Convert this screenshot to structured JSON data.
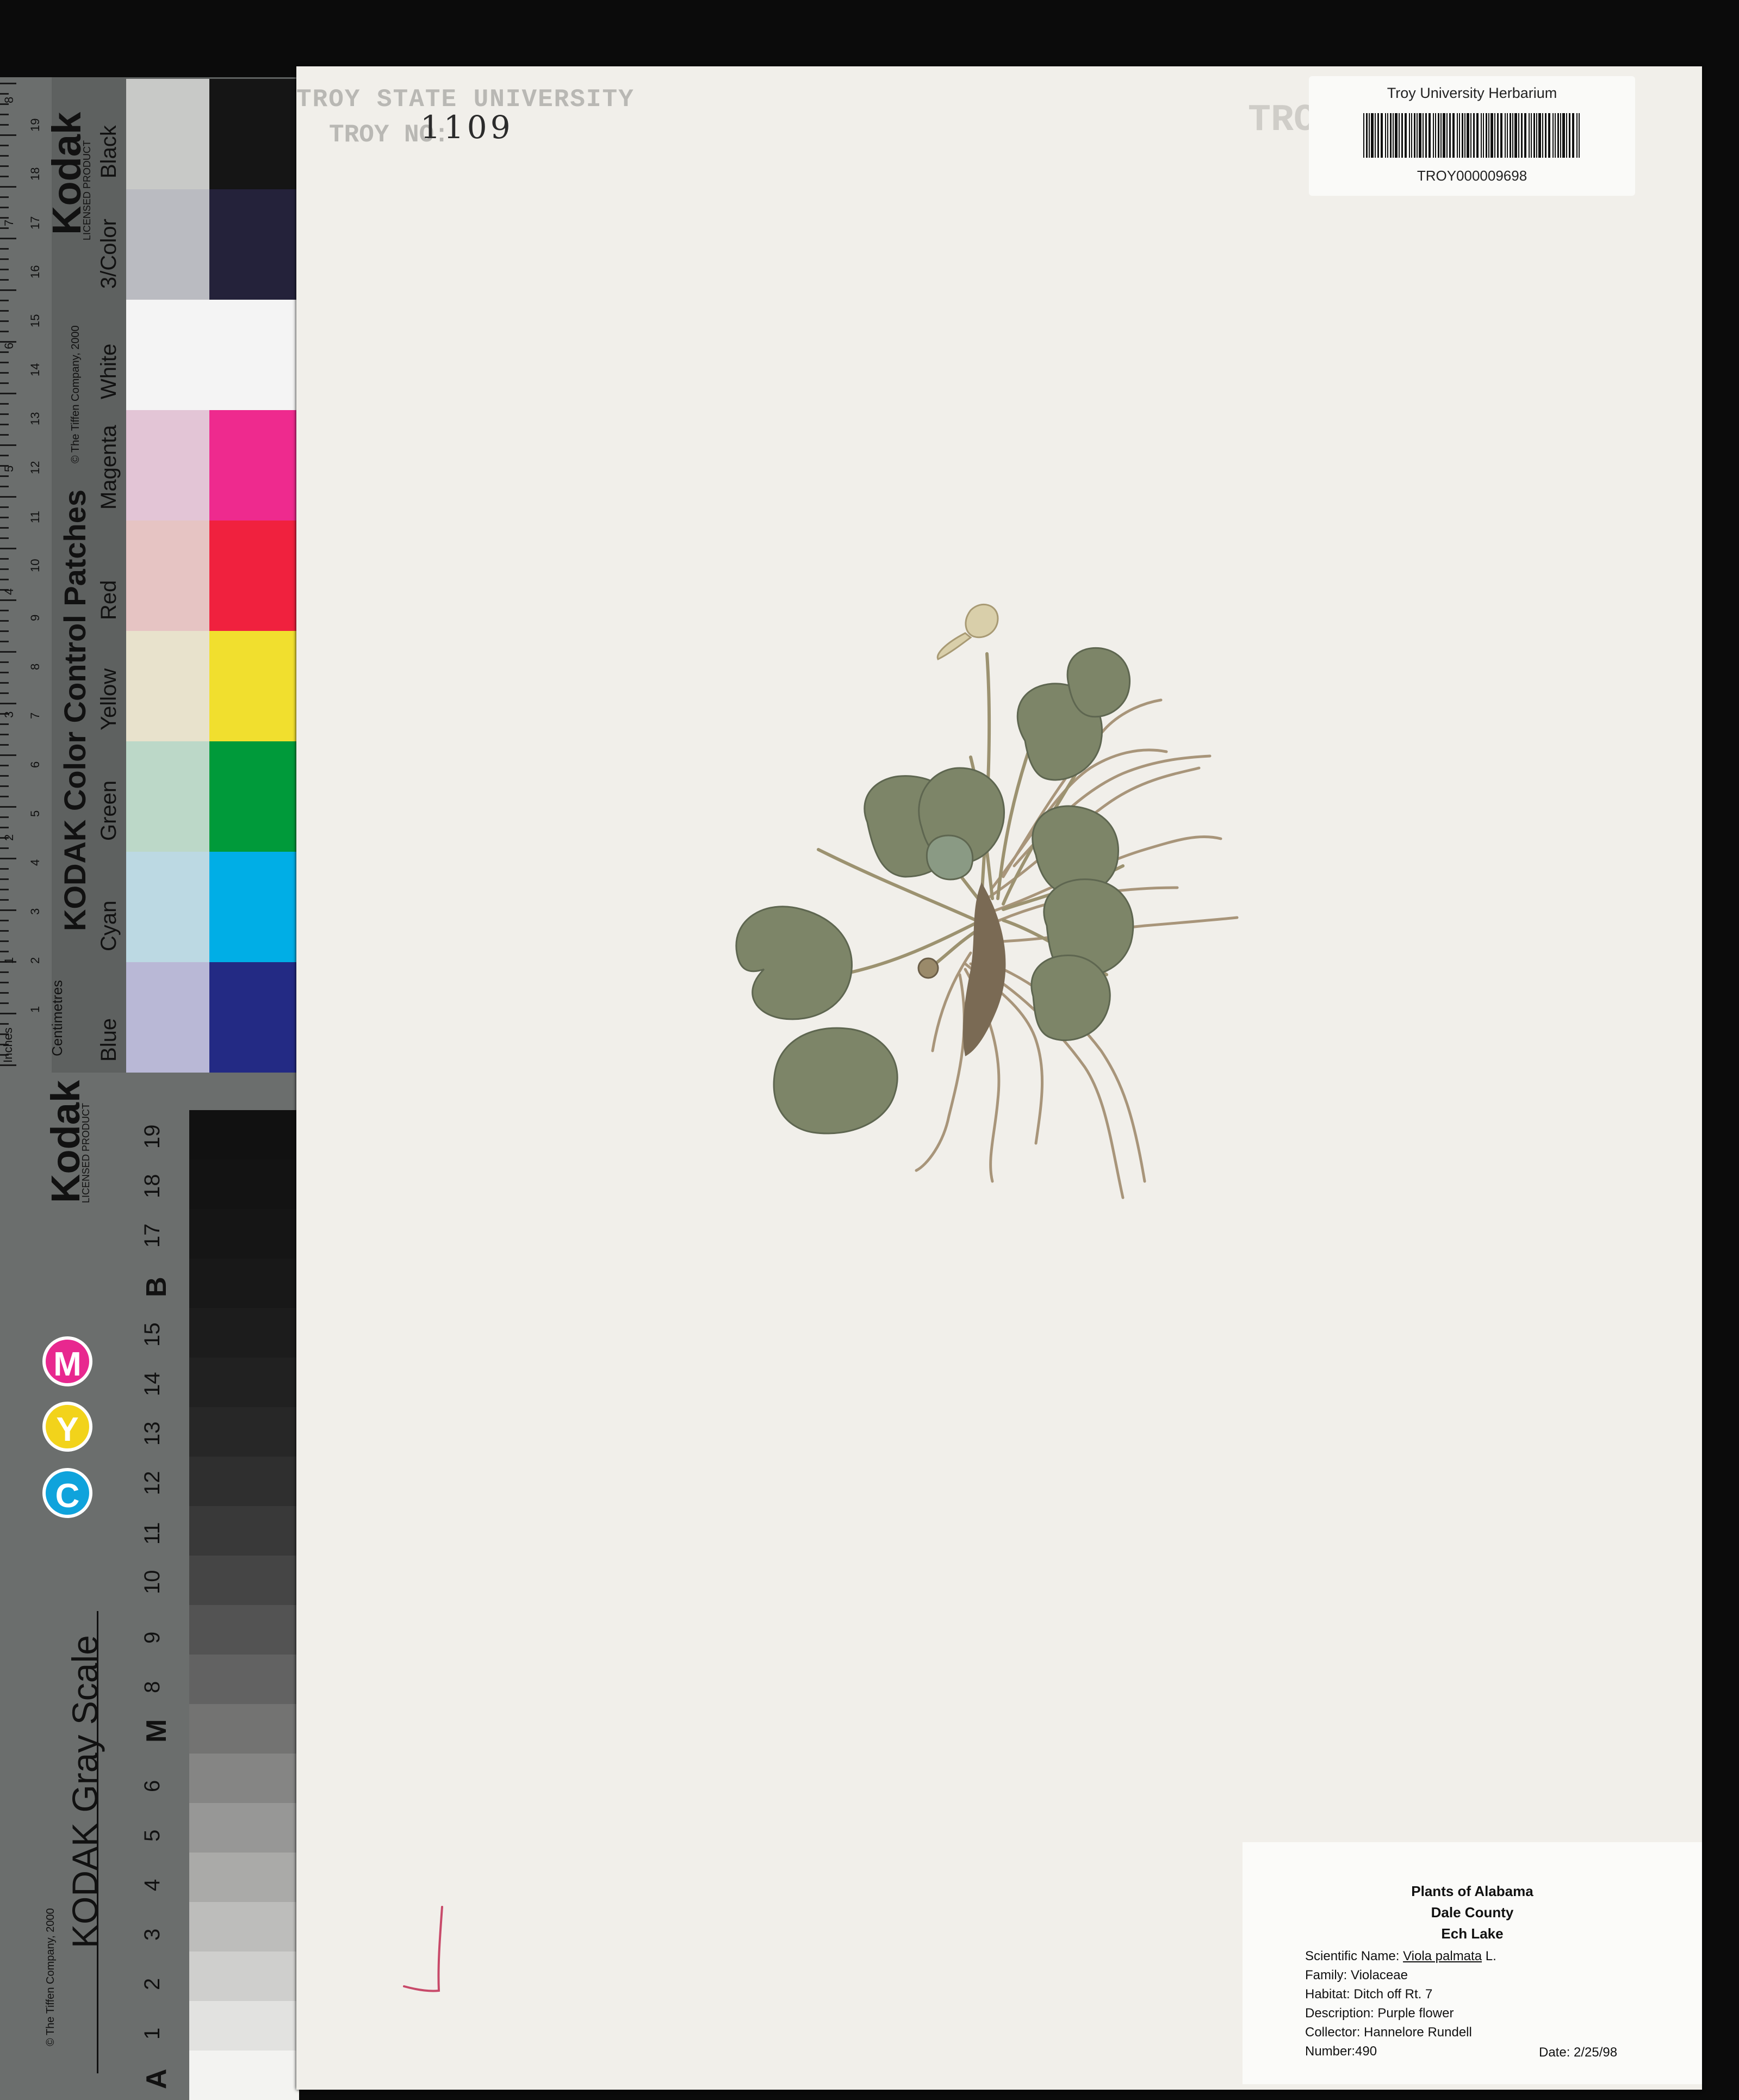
{
  "color_strip": {
    "ruler_label_inches": "Inches",
    "ruler_label_cm": "Centimetres",
    "ruler_cm_numbers": [
      "1",
      "2",
      "3",
      "4",
      "5",
      "6",
      "7",
      "8",
      "9",
      "10",
      "11",
      "12",
      "13",
      "14",
      "15",
      "16",
      "17",
      "18",
      "19"
    ],
    "ruler_inch_numbers": [
      "1",
      "2",
      "3",
      "4",
      "5",
      "6",
      "7",
      "8"
    ],
    "title": "KODAK Color Control Patches",
    "copyright": "© The Tiffen Company, 2000",
    "brand": "Kodak",
    "brand_sub": "LICENSED PRODUCT",
    "patches": [
      {
        "label": "Blue",
        "light": "#b9b8d6",
        "dark": "#232a84"
      },
      {
        "label": "Cyan",
        "light": "#bcd9e3",
        "dark": "#00aee6"
      },
      {
        "label": "Green",
        "light": "#bcd8c8",
        "dark": "#009a3a"
      },
      {
        "label": "Yellow",
        "light": "#e8e2cc",
        "dark": "#f1df2e"
      },
      {
        "label": "Red",
        "light": "#e6c4c3",
        "dark": "#f0213e"
      },
      {
        "label": "Magenta",
        "light": "#e3c5d6",
        "dark": "#ee2a8e"
      },
      {
        "label": "White",
        "light": "#f4f4f4",
        "dark": "#f4f4f4"
      },
      {
        "label": "3/Color",
        "light": "#babbc1",
        "dark": "#24223a"
      },
      {
        "label": "Black",
        "light": "#c8c9c7",
        "dark": "#151515"
      }
    ]
  },
  "gray_strip": {
    "title": "KODAK Gray Scale",
    "copyright": "© The Tiffen Company, 2000",
    "brand": "Kodak",
    "brand_sub": "LICENSED PRODUCT",
    "cym": [
      "C",
      "Y",
      "M"
    ],
    "cym_colors": [
      "#0fa3dc",
      "#f2d31b",
      "#e8288f"
    ],
    "steps": [
      "A",
      "1",
      "2",
      "3",
      "4",
      "5",
      "6",
      "M",
      "8",
      "9",
      "10",
      "11",
      "12",
      "13",
      "14",
      "15",
      "B",
      "17",
      "18",
      "19"
    ],
    "step_colors": [
      "#f3f3f1",
      "#e2e2e0",
      "#cfcfcd",
      "#bdbdbb",
      "#aaaaa8",
      "#979796",
      "#858584",
      "#737372",
      "#626262",
      "#535353",
      "#454545",
      "#393939",
      "#2f2f2f",
      "#272727",
      "#212121",
      "#1c1c1c",
      "#181818",
      "#151515",
      "#131313",
      "#111111"
    ]
  },
  "sheet": {
    "stamp_university": "TROY STATE UNIVERSITY",
    "stamp_troy_no": "TROY NO:",
    "stamp_number": "1109",
    "ghost_stamp": "TRO",
    "barcode_title": "Troy University Herbarium",
    "barcode_id": "TROY000009698",
    "label": {
      "line1": "Plants of Alabama",
      "line2": "Dale County",
      "line3": "Ech Lake",
      "scientific_name_key": "Scientific Name:",
      "scientific_name_value": "Viola palmata",
      "scientific_name_author": "L.",
      "family": "Family: Violaceae",
      "habitat": "Habitat: Ditch off Rt. 7",
      "description": "Description: Purple flower",
      "collector": "Collector: Hannelore Rundell",
      "number": "Number:490",
      "date": "Date: 2/25/98"
    }
  }
}
